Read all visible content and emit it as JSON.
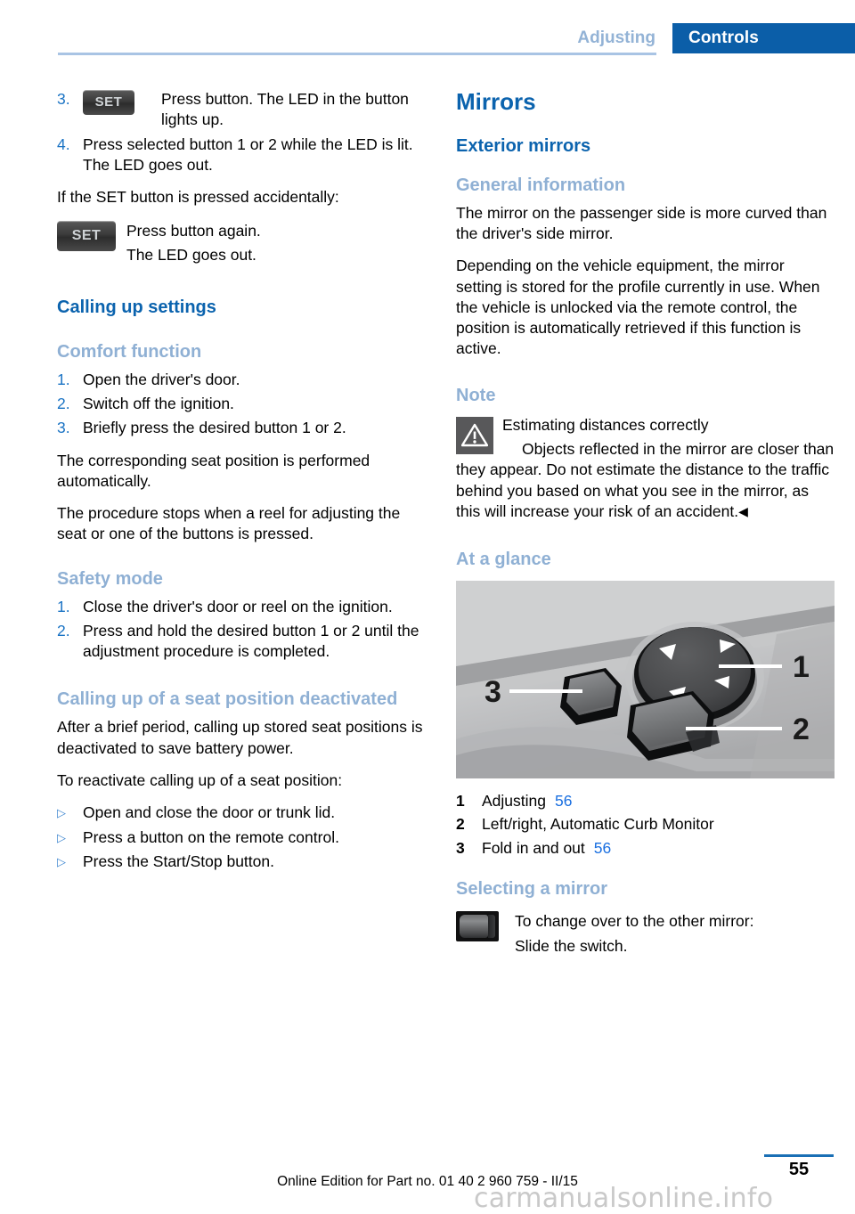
{
  "header": {
    "chapter": "Adjusting",
    "section": "Controls"
  },
  "left_column": {
    "steps_continued": [
      {
        "number": "3.",
        "button_label": "SET",
        "text": "Press button. The LED in the button lights up."
      },
      {
        "number": "4.",
        "text": "Press selected button 1 or 2 while the LED is lit. The LED goes out."
      }
    ],
    "accidental_press_intro": "If the SET button is pressed accidentally:",
    "accidental_press": {
      "button_label": "SET",
      "line1": "Press button again.",
      "line2": "The LED goes out."
    },
    "calling_up_settings": {
      "heading": "Calling up settings",
      "comfort_function": {
        "heading": "Comfort function",
        "steps": [
          {
            "number": "1.",
            "text": "Open the driver's door."
          },
          {
            "number": "2.",
            "text": "Switch off the ignition."
          },
          {
            "number": "3.",
            "text": "Briefly press the desired button 1 or 2."
          }
        ],
        "paragraphs": [
          "The corresponding seat position is performed automatically.",
          "The procedure stops when a reel for adjusting the seat or one of the buttons is pressed."
        ]
      },
      "safety_mode": {
        "heading": "Safety mode",
        "steps": [
          {
            "number": "1.",
            "text": "Close the driver's door or reel on the ignition."
          },
          {
            "number": "2.",
            "text": "Press and hold the desired button 1 or 2 until the adjustment procedure is completed."
          }
        ]
      },
      "deactivated": {
        "heading": "Calling up of a seat position deactivated",
        "paragraphs": [
          "After a brief period, calling up stored seat positions is deactivated to save battery power.",
          "To reactivate calling up of a seat position:"
        ],
        "bullets": [
          "Open and close the door or trunk lid.",
          "Press a button on the remote control.",
          "Press the Start/Stop button."
        ]
      }
    }
  },
  "right_column": {
    "title": "Mirrors",
    "exterior_mirrors": {
      "heading": "Exterior mirrors",
      "general_information": {
        "heading": "General information",
        "paragraphs": [
          "The mirror on the passenger side is more curved than the driver's side mirror.",
          "Depending on the vehicle equipment, the mirror setting is stored for the profile currently in use. When the vehicle is unlocked via the remote control, the position is automatically retrieved if this function is active."
        ]
      },
      "note": {
        "heading": "Note",
        "icon": "warning-triangle-icon",
        "title": "Estimating distances correctly",
        "body": "Objects reflected in the mirror are closer than they appear. Do not estimate the distance to the traffic behind you based on what you see in the mirror, as this will increase your risk of an accident.",
        "end_marker": "◀"
      },
      "at_a_glance": {
        "heading": "At a glance",
        "figure_labels": [
          "1",
          "2",
          "3"
        ],
        "legend": [
          {
            "number": "1",
            "text": "Adjusting",
            "page": "56"
          },
          {
            "number": "2",
            "text": "Left/right, Automatic Curb Monitor",
            "page": ""
          },
          {
            "number": "3",
            "text": "Fold in and out",
            "page": "56"
          }
        ]
      },
      "selecting_a_mirror": {
        "heading": "Selecting a mirror",
        "icon": "rocker-switch-icon",
        "line1": "To change over to the other mirror:",
        "line2": "Slide the switch."
      }
    }
  },
  "footer": {
    "edition_text": "Online Edition for Part no. 01 40 2 960 759 - II/15",
    "page_number": "55",
    "watermark": "carmanualsonline.info"
  },
  "colors": {
    "tab_blue": "#0b5ea8",
    "heading_blue": "#0b63ae",
    "subheading_blue": "#8fb0d4",
    "rule_blue": "#a9c4e4",
    "list_number_blue": "#1a73c4",
    "page_ref_blue": "#1a6fe0"
  }
}
